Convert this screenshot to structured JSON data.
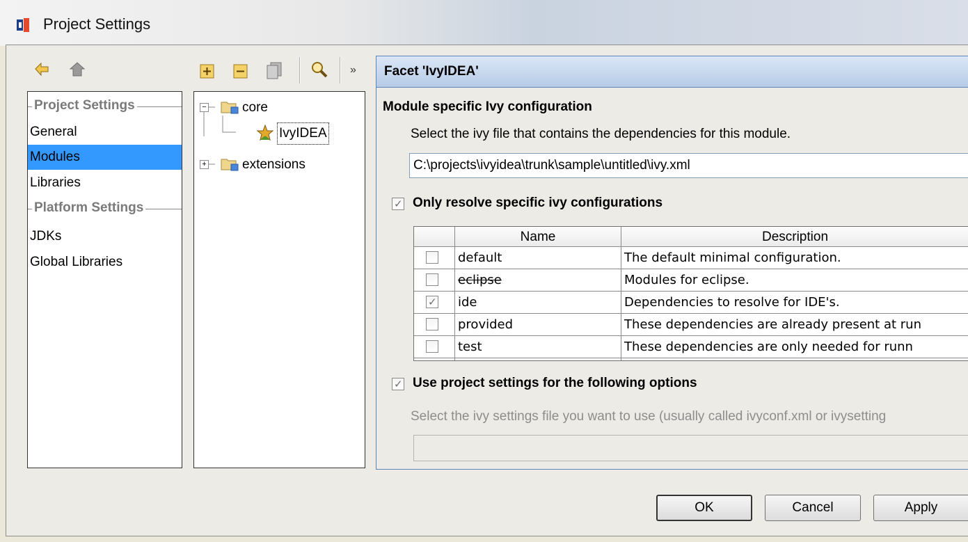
{
  "window": {
    "title": "Project Settings",
    "logo_icon": "intellij-logo-icon"
  },
  "left_toolbar": {
    "buttons": [
      {
        "name": "back-arrow-icon"
      },
      {
        "name": "forward-arrow-icon"
      }
    ]
  },
  "tree_toolbar": {
    "buttons": [
      {
        "name": "add-icon"
      },
      {
        "name": "remove-icon"
      },
      {
        "name": "copy-icon"
      },
      {
        "name": "find-usages-icon"
      }
    ],
    "overflow_label": "»"
  },
  "categories": {
    "project_header": "Project Settings",
    "project_items": [
      "General",
      "Modules",
      "Libraries"
    ],
    "platform_header": "Platform Settings",
    "platform_items": [
      "JDKs",
      "Global Libraries"
    ],
    "selected": "Modules"
  },
  "module_tree": {
    "nodes": [
      {
        "label": "core",
        "expander": "−"
      },
      {
        "label": "IvyIDEA"
      },
      {
        "label": "extensions",
        "expander": "+"
      }
    ]
  },
  "facet": {
    "title": "Facet 'IvyIDEA'",
    "section1_title": "Module specific Ivy configuration",
    "ivy_file_prompt": "Select the ivy file that contains the dependencies for this module.",
    "ivy_file_path": "C:\\projects\\ivyidea\\trunk\\sample\\untitled\\ivy.xml",
    "only_resolve_label": "Only resolve specific ivy configurations",
    "only_resolve_checked": true,
    "table": {
      "headers": [
        "Name",
        "Description"
      ],
      "rows": [
        {
          "checked": false,
          "name": "default",
          "description": "The default minimal configuration.",
          "strike": false
        },
        {
          "checked": false,
          "name": "eclipse",
          "description": "Modules for eclipse.",
          "strike": true
        },
        {
          "checked": true,
          "name": "ide",
          "description": "Dependencies to resolve for IDE's.",
          "strike": false
        },
        {
          "checked": false,
          "name": "provided",
          "description": "These dependencies are already present at run",
          "strike": false
        },
        {
          "checked": false,
          "name": "test",
          "description": "These dependencies are only needed for runn",
          "strike": false
        }
      ]
    },
    "use_project_label": "Use project settings for the following options",
    "use_project_checked": true,
    "settings_prompt": "Select the ivy settings file you want to use (usually called ivyconf.xml or ivysetting",
    "settings_path": ""
  },
  "buttons": {
    "ok": "OK",
    "cancel": "Cancel",
    "apply": "Apply"
  }
}
